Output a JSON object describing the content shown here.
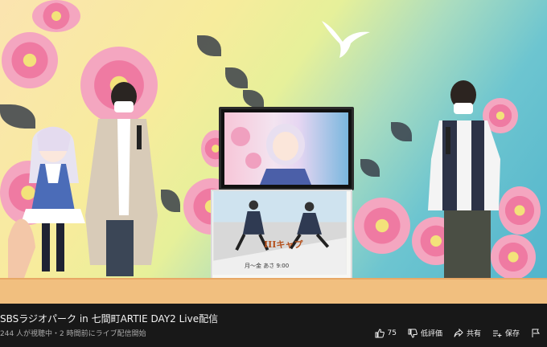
{
  "video": {
    "title": "SBSラジオパーク in 七間町ARTIE DAY2 Live配信",
    "meta": "244 人が視聴中・2 時間前にライブ配信開始",
    "poster_title": "IIIキャプ",
    "poster_date": "月～金 あさ 9:00"
  },
  "actions": {
    "like_count": "75",
    "dislike_label": "低評価",
    "share_label": "共有",
    "save_label": "保存"
  },
  "icons": [
    "thumbs-up-icon",
    "thumbs-down-icon",
    "share-icon",
    "save-playlist-icon",
    "flag-icon"
  ],
  "colors": {
    "background": "#181818",
    "text": "#f1f1f1",
    "meta": "#aaaaaa"
  }
}
